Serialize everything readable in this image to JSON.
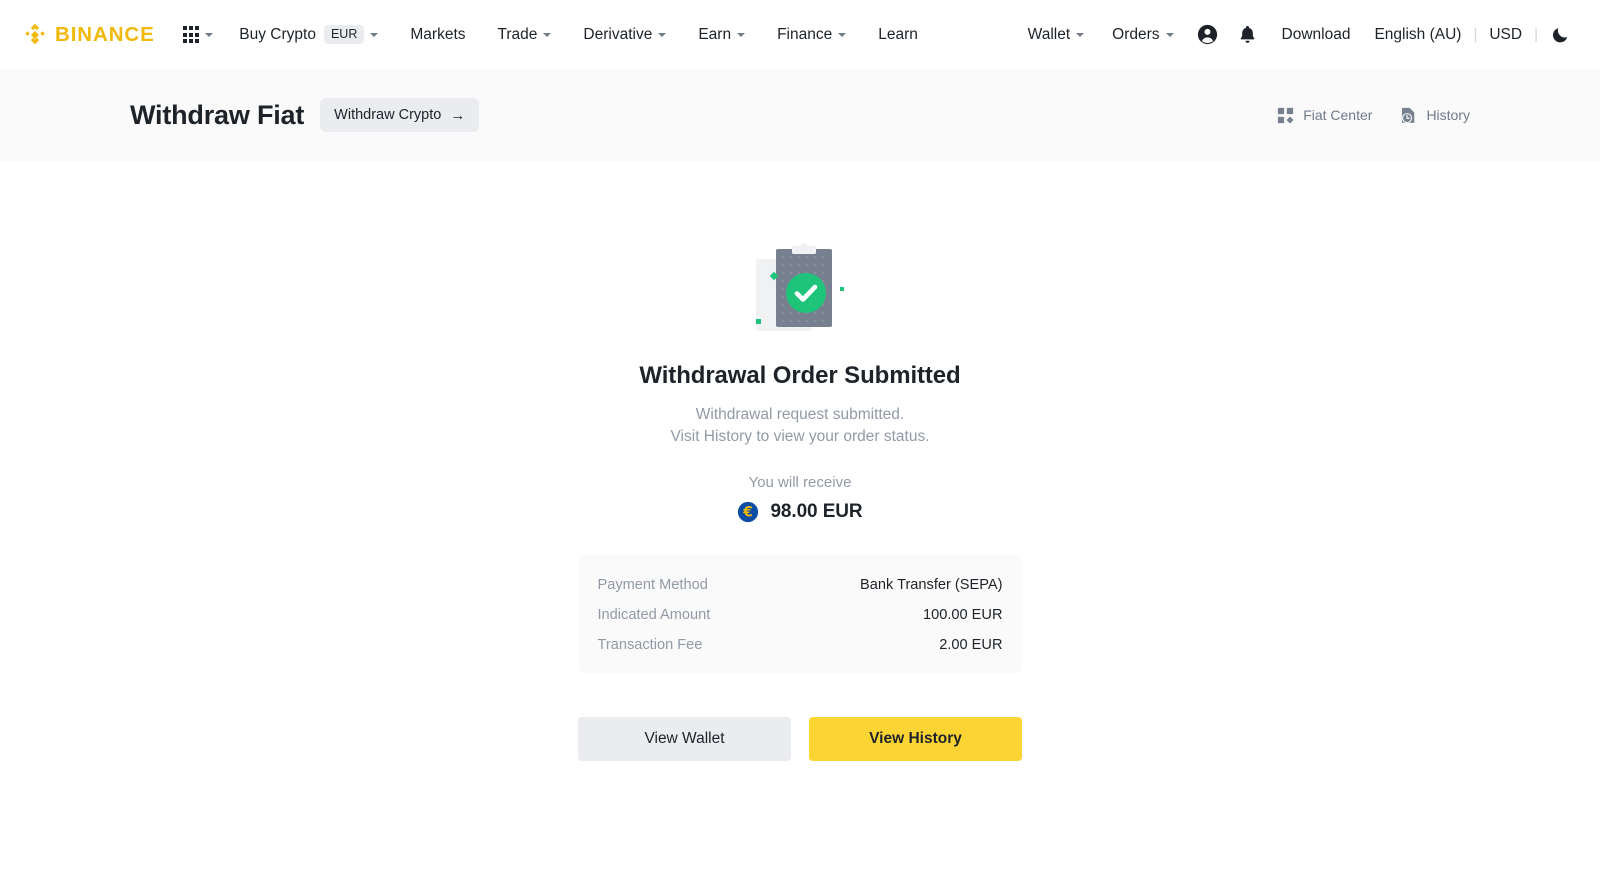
{
  "brand": {
    "name": "BINANCE",
    "logo_color": "#F0B90B"
  },
  "topnav": {
    "apps_icon": "grid-apps-icon",
    "left_items": [
      {
        "label": "Buy Crypto",
        "chip": "EUR",
        "has_caret": true
      },
      {
        "label": "Markets",
        "chip": null,
        "has_caret": false
      },
      {
        "label": "Trade",
        "chip": null,
        "has_caret": true
      },
      {
        "label": "Derivative",
        "chip": null,
        "has_caret": true
      },
      {
        "label": "Earn",
        "chip": null,
        "has_caret": true
      },
      {
        "label": "Finance",
        "chip": null,
        "has_caret": true
      },
      {
        "label": "Learn",
        "chip": null,
        "has_caret": false
      }
    ],
    "right_items": [
      {
        "label": "Wallet",
        "has_caret": true
      },
      {
        "label": "Orders",
        "has_caret": true
      }
    ],
    "profile_icon": "user-account-icon",
    "notification_icon": "bell-icon",
    "download_label": "Download",
    "language": "English (AU)",
    "currency": "USD",
    "separator": "|",
    "theme_icon": "moon-icon"
  },
  "header": {
    "title": "Withdraw Fiat",
    "switch_button": {
      "label": "Withdraw Crypto",
      "icon": "arrow-right-icon",
      "arrow": "→"
    },
    "actions": [
      {
        "label": "Fiat Center",
        "icon": "fiat-center-grid-icon"
      },
      {
        "label": "History",
        "icon": "history-clock-icon"
      }
    ]
  },
  "result": {
    "illustration": "clipboard-success-check-icon",
    "title": "Withdrawal Order Submitted",
    "subtitle_line1": "Withdrawal request submitted.",
    "subtitle_line2": "Visit History to view your order status.",
    "receive_label": "You will receive",
    "receive_amount": "98.00 EUR",
    "currency_icon": "euro-coin-icon",
    "details": [
      {
        "key": "Payment Method",
        "value": "Bank Transfer (SEPA)"
      },
      {
        "key": "Indicated Amount",
        "value": "100.00 EUR"
      },
      {
        "key": "Transaction Fee",
        "value": "2.00 EUR"
      }
    ],
    "buttons": {
      "secondary": "View Wallet",
      "primary": "View History"
    }
  },
  "colors": {
    "brand_yellow": "#F0B90B",
    "primary_button": "#FCD535",
    "success_green": "#1FC47B",
    "text_primary": "#1E2329",
    "text_secondary": "#929AA5",
    "surface_gray": "#FAFAFA",
    "chip_gray": "#EAECEF",
    "euro_blue": "#0E4DA4"
  }
}
